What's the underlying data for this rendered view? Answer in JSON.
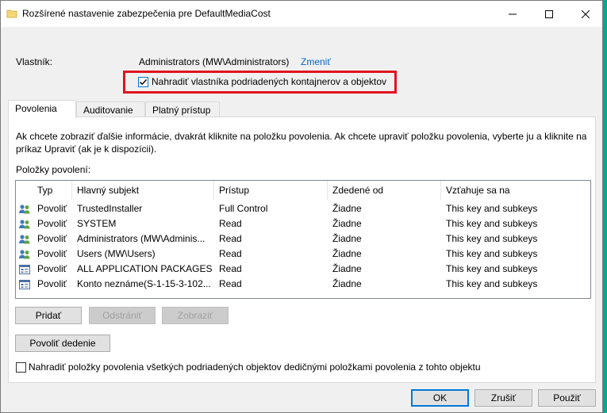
{
  "window": {
    "title": "Rozšírené nastavenie zabezpečenia pre DefaultMediaCost"
  },
  "owner": {
    "label": "Vlastník:",
    "value": "Administrators (MW\\Administrators)",
    "change_link": "Zmeniť",
    "replace_owner_label": "Nahradiť vlastníka podriadených kontajnerov a objektov",
    "replace_owner_checked": true
  },
  "tabs": [
    {
      "label": "Povolenia",
      "active": true
    },
    {
      "label": "Auditovanie",
      "active": false
    },
    {
      "label": "Platný prístup",
      "active": false
    }
  ],
  "info_text_1": "Ak chcete zobraziť ďalšie informácie, dvakrát kliknite na položku povolenia. Ak chcete upraviť položku povolenia, vyberte ju a kliknite na",
  "info_text_2": "príkaz Upraviť (ak je k dispozícii).",
  "entries_label": "Položky povolení:",
  "columns": [
    "Typ",
    "Hlavný subjekt",
    "Prístup",
    "Zdedené od",
    "Vzťahuje sa na"
  ],
  "rows": [
    {
      "icon": "users-icon",
      "type": "Povoliť",
      "principal": "TrustedInstaller",
      "access": "Full Control",
      "inherited": "Žiadne",
      "applies": "This key and subkeys"
    },
    {
      "icon": "users-icon",
      "type": "Povoliť",
      "principal": "SYSTEM",
      "access": "Read",
      "inherited": "Žiadne",
      "applies": "This key and subkeys"
    },
    {
      "icon": "users-icon",
      "type": "Povoliť",
      "principal": "Administrators (MW\\Adminis...",
      "access": "Read",
      "inherited": "Žiadne",
      "applies": "This key and subkeys"
    },
    {
      "icon": "users-icon",
      "type": "Povoliť",
      "principal": "Users (MW\\Users)",
      "access": "Read",
      "inherited": "Žiadne",
      "applies": "This key and subkeys"
    },
    {
      "icon": "app-package-icon",
      "type": "Povoliť",
      "principal": "ALL APPLICATION PACKAGES",
      "access": "Read",
      "inherited": "Žiadne",
      "applies": "This key and subkeys"
    },
    {
      "icon": "app-package-icon",
      "type": "Povoliť",
      "principal": "Konto neznáme(S-1-15-3-102...",
      "access": "Read",
      "inherited": "Žiadne",
      "applies": "This key and subkeys"
    }
  ],
  "buttons": {
    "add": "Pridať",
    "remove": "Odstrániť",
    "view": "Zobraziť",
    "enable_inheritance": "Povoliť dedenie",
    "ok": "OK",
    "cancel": "Zrušiť",
    "apply": "Použiť"
  },
  "replace_child_label": "Nahradiť položky povolenia všetkých podriadených objektov dedičnými položkami povolenia z tohto objektu",
  "replace_child_checked": false,
  "colors": {
    "highlight_border": "#e0141e",
    "link": "#0066cc",
    "desktop": "#00a98f"
  }
}
